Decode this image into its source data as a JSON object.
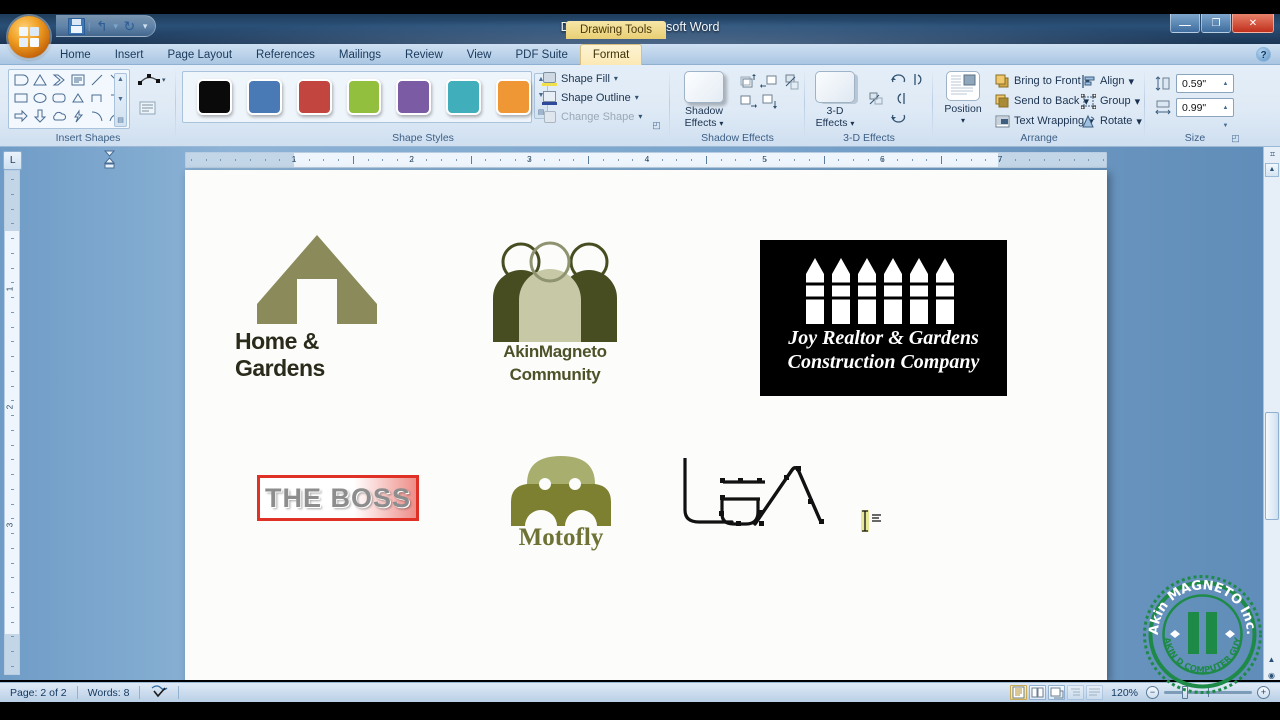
{
  "window": {
    "document_title": "Document1 - Microsoft Word",
    "contextual_tab_group": "Drawing Tools",
    "minimize_glyph": "—",
    "restore_glyph": "❐",
    "close_glyph": "✕",
    "help_glyph": "?",
    "office_button_name": "Office Button",
    "quick_access": [
      {
        "name": "save",
        "glyph": ""
      },
      {
        "name": "undo",
        "glyph": "↰"
      },
      {
        "name": "redo",
        "glyph": "↻"
      },
      {
        "name": "customize",
        "glyph": "▾"
      }
    ]
  },
  "tabs": [
    {
      "label": "Home",
      "active": false
    },
    {
      "label": "Insert",
      "active": false
    },
    {
      "label": "Page Layout",
      "active": false
    },
    {
      "label": "References",
      "active": false
    },
    {
      "label": "Mailings",
      "active": false
    },
    {
      "label": "Review",
      "active": false
    },
    {
      "label": "View",
      "active": false
    },
    {
      "label": "PDF Suite",
      "active": false
    },
    {
      "label": "Format",
      "active": true
    }
  ],
  "ribbon": {
    "groups": [
      {
        "label": "Insert Shapes"
      },
      {
        "label": "Shape Styles"
      },
      {
        "label": "Shadow Effects"
      },
      {
        "label": "3-D Effects"
      },
      {
        "label": "Arrange"
      },
      {
        "label": "Size"
      }
    ],
    "shape_styles": {
      "swatches": [
        "#0a0a0a",
        "#4a7ab5",
        "#c2453f",
        "#93bf3e",
        "#7a5ba4",
        "#40aebb",
        "#ef9635"
      ],
      "commands": [
        {
          "label": "Shape Fill",
          "icon": "fill-bucket-icon",
          "enabled": true,
          "caret": "▾"
        },
        {
          "label": "Shape Outline",
          "icon": "pen-outline-icon",
          "enabled": true,
          "caret": "▾"
        },
        {
          "label": "Change Shape",
          "icon": "change-shape-icon",
          "enabled": false,
          "caret": "▾"
        }
      ]
    },
    "shadow_effects": {
      "button_line1": "Shadow",
      "button_line2": "Effects",
      "caret": "▾"
    },
    "three_d_effects": {
      "button_line1": "3-D",
      "button_line2": "Effects",
      "caret": "▾"
    },
    "arrange": {
      "position_label": "Position",
      "position_caret": "▾",
      "commands": [
        {
          "label": "Bring to Front",
          "icon": "bring-to-front-icon",
          "caret": "▾"
        },
        {
          "label": "Send to Back",
          "icon": "send-to-back-icon",
          "caret": "▾"
        },
        {
          "label": "Text Wrapping",
          "icon": "text-wrapping-icon",
          "caret": "▾"
        },
        {
          "label": "Align",
          "icon": "align-icon",
          "caret": "▾"
        },
        {
          "label": "Group",
          "icon": "group-icon",
          "caret": "▾"
        },
        {
          "label": "Rotate",
          "icon": "rotate-icon",
          "caret": "▾"
        }
      ]
    },
    "size": {
      "height_value": "0.59\"",
      "width_value": "0.99\"",
      "height_icon": "shape-height-icon",
      "width_icon": "shape-width-icon",
      "dialog_launcher": "◰"
    }
  },
  "rulers": {
    "horizontal_numbers": [
      "1",
      "2",
      "3",
      "4",
      "5",
      "6",
      "7"
    ],
    "vertical_numbers": [
      "1",
      "2",
      "3"
    ],
    "tab_selector_glyph": "L"
  },
  "document": {
    "objects": [
      {
        "name": "home-and-gardens-logo",
        "type": "house-logo",
        "caption": "Home & Gardens",
        "color": "#8a8a5a"
      },
      {
        "name": "akinmagneto-community-logo",
        "type": "people-logo",
        "caption_line1": "AkinMagneto",
        "caption_line2": "Community",
        "color_dark": "#474d21",
        "color_light": "#c6c8a6"
      },
      {
        "name": "joy-realtor-logo",
        "type": "fence-logo",
        "caption_line1": "Joy Realtor & Gardens",
        "caption_line2": "Construction Company",
        "background": "#000000",
        "foreground": "#ffffff",
        "picket_count": 6
      },
      {
        "name": "the-boss-logo",
        "type": "banner-logo",
        "caption": "THE BOSS",
        "border_color": "#e03127"
      },
      {
        "name": "motofly-logo",
        "type": "car-logo",
        "caption": "Motofly",
        "color_body": "#7c8030",
        "color_roof": "#a8ae6e"
      },
      {
        "name": "lea-freeform-drawing",
        "type": "freeform-scribble",
        "caption": "LEA",
        "selected": true
      }
    ]
  },
  "statusbar": {
    "page": "Page: 2 of 2",
    "words": "Words: 8",
    "proofing_icon": "proofing-errors-icon",
    "zoom_percent": "120%",
    "zoom_out_glyph": "−",
    "zoom_in_glyph": "+",
    "view_buttons": [
      {
        "name": "print-layout-view",
        "active": true
      },
      {
        "name": "full-screen-reading-view",
        "active": false
      },
      {
        "name": "web-layout-view",
        "active": false
      },
      {
        "name": "outline-view",
        "active": false,
        "dim": true
      },
      {
        "name": "draft-view",
        "active": false,
        "dim": true
      }
    ]
  },
  "watermark": {
    "top_text": "Akin MAGNETO Inc.",
    "bottom_text": "AKIN D COMPUTER GUY",
    "icon": "pause-icon",
    "color": "#1e8a47"
  }
}
